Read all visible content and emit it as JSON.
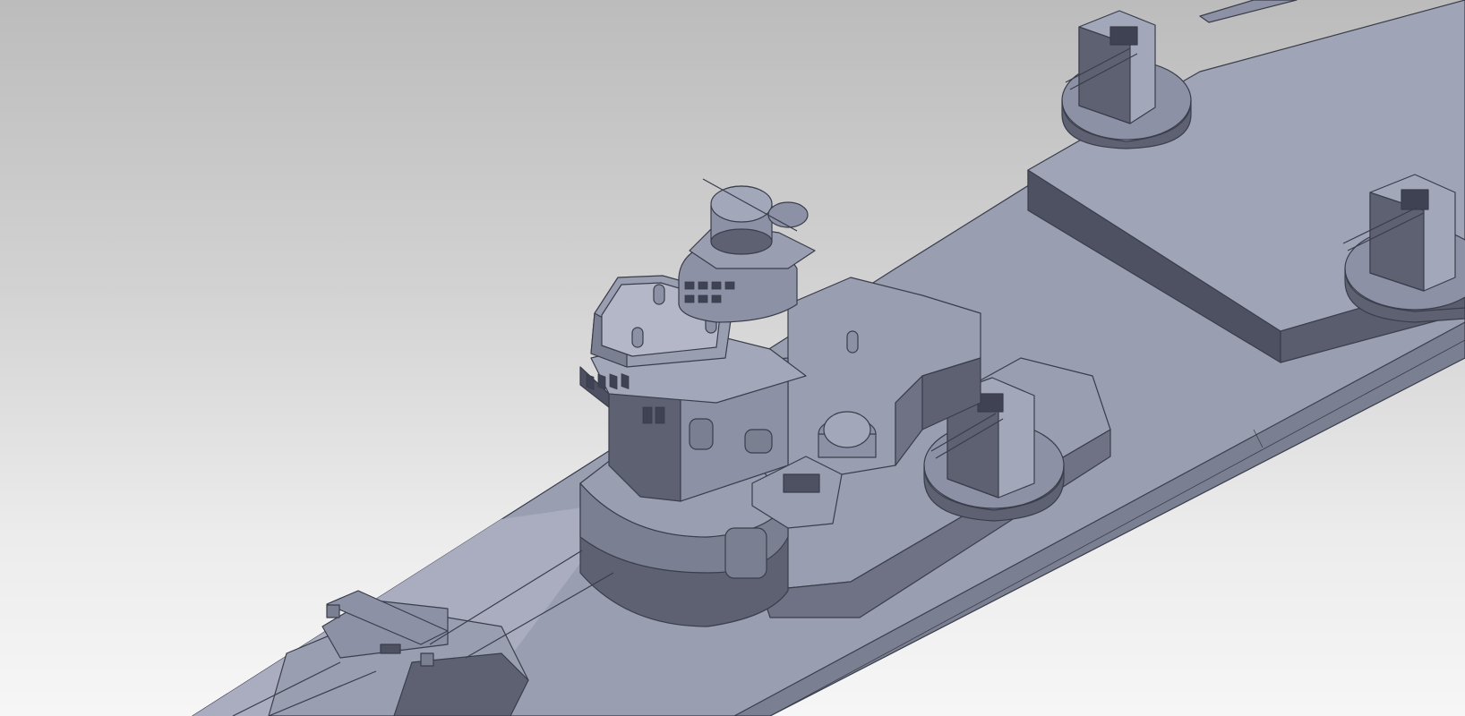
{
  "viewport": {
    "background_top": "#bcbcbc",
    "background_bottom": "#f6f6f6"
  },
  "model": {
    "face_light": "#a3a7ba",
    "face_mid": "#8d91a5",
    "face_dark": "#5e6172",
    "face_darker": "#4a4d5c",
    "edge_color": "#3a3d4a"
  }
}
